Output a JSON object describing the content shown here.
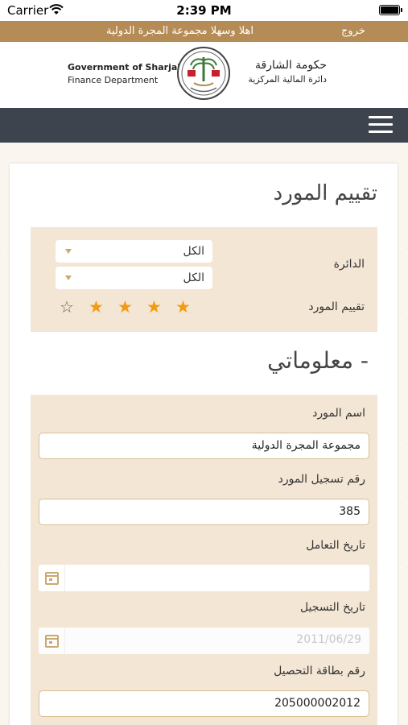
{
  "status_bar": {
    "carrier": "Carrier",
    "time": "2:39 PM"
  },
  "top_strip": {
    "logout": "خروج",
    "welcome": "اهلا وسهلا مجموعة المجرة الدولية"
  },
  "logo": {
    "en_line1": "Government of Sharjah",
    "en_line2": "Finance Department",
    "ar_line1": "حكومة الشارقة",
    "ar_line2": "دائرة المالية المركزية"
  },
  "page": {
    "title": "تقييم المورد"
  },
  "filters": {
    "department_label": "الدائرة",
    "department_value": "الكل",
    "secondary_value": "الكل",
    "rating_label": "تقييم المورد",
    "rating": 4,
    "rating_max": 5
  },
  "section": {
    "title": "- معلوماتي"
  },
  "info": {
    "supplier_name_label": "اسم المورد",
    "supplier_name_value": "مجموعة المجرة الدولية",
    "registration_number_label": "رقم تسجيل المورد",
    "registration_number_value": "385",
    "dealing_date_label": "تاريخ التعامل",
    "dealing_date_value": "",
    "registration_date_label": "تاريخ التسجيل",
    "registration_date_value": "2011/06/29",
    "collection_card_label": "رقم بطاقة التحصيل",
    "collection_card_value": "205000002012"
  },
  "colors": {
    "accent": "#b58b56",
    "nav": "#3d444d",
    "panel": "#f3e6d5",
    "star": "#f39a10"
  },
  "icons": [
    "wifi-icon",
    "battery-icon",
    "emblem-icon",
    "menu-icon",
    "dropdown-arrow-icon",
    "star-icon",
    "calendar-icon"
  ]
}
